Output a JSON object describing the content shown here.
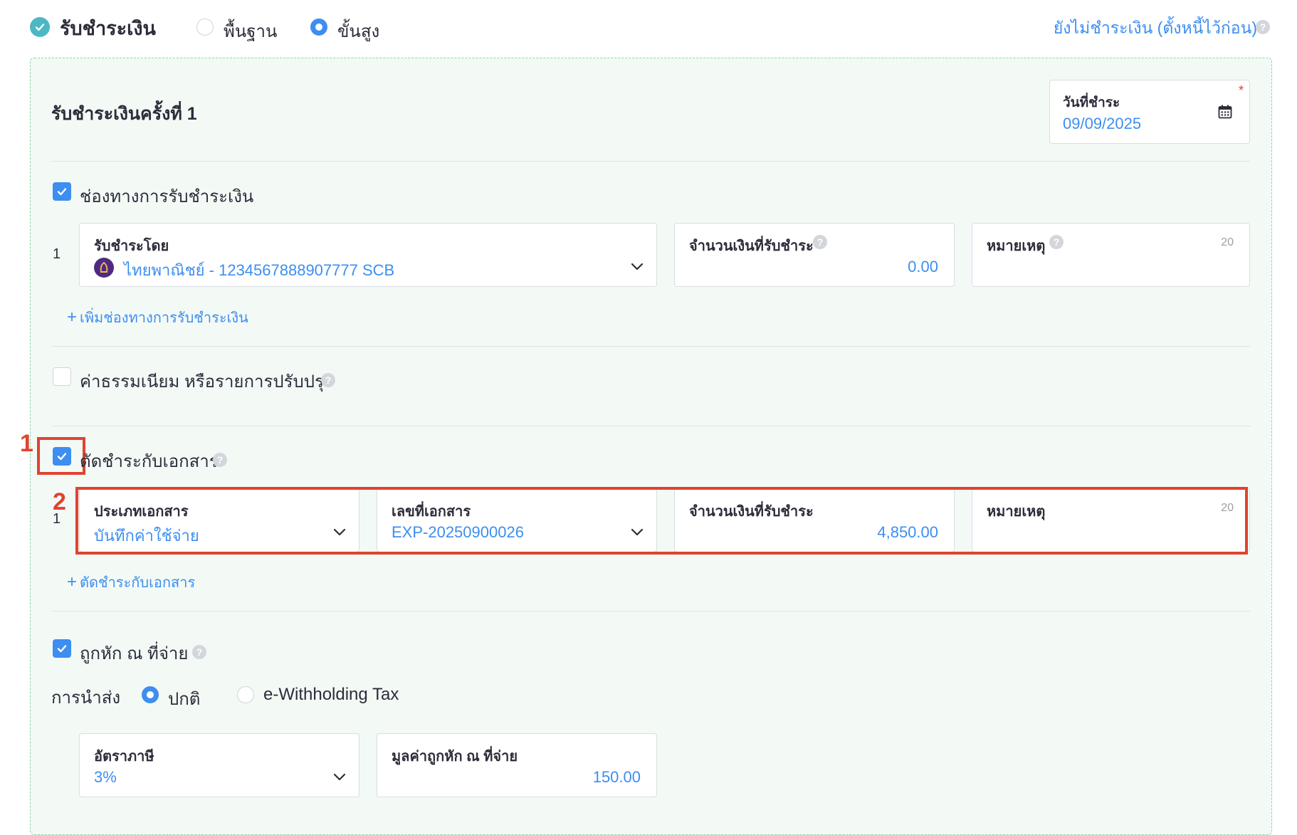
{
  "header": {
    "title": "รับชำระเงิน",
    "mode_basic": "พื้นฐาน",
    "mode_advanced": "ขั้นสูง",
    "unpaid_link": "ยังไม่ชำระเงิน (ตั้งหนี้ไว้ก่อน)"
  },
  "payment": {
    "title": "รับชำระเงินครั้งที่ 1",
    "date_label": "วันที่ชำระ",
    "date_value": "09/09/2025",
    "required_mark": "*"
  },
  "channels": {
    "label": "ช่องทางการรับชำระเงิน",
    "row_number": "1",
    "received_by_label": "รับชำระโดย",
    "received_by_value": "ไทยพาณิชย์ - 1234567888907777 SCB",
    "amount_label": "จำนวนเงินที่รับชำระ",
    "amount_value": "0.00",
    "note_label": "หมายเหตุ",
    "note_count": "20",
    "add_link": "เพิ่มช่องทางการรับชำระเงิน"
  },
  "fees": {
    "label": "ค่าธรรมเนียม หรือรายการปรับปรุง"
  },
  "offset": {
    "label": "ตัดชำระกับเอกสาร",
    "row_number": "1",
    "doc_type_label": "ประเภทเอกสาร",
    "doc_type_value": "บันทึกค่าใช้จ่าย",
    "doc_no_label": "เลขที่เอกสาร",
    "doc_no_value": "EXP-20250900026",
    "amount_label": "จำนวนเงินที่รับชำระ",
    "amount_value": "4,850.00",
    "note_label": "หมายเหตุ",
    "note_count": "20",
    "add_link": "ตัดชำระกับเอกสาร"
  },
  "withholding": {
    "label": "ถูกหัก ณ ที่จ่าย",
    "delivery_label": "การนำส่ง",
    "option_normal": "ปกติ",
    "option_ewht": "e-Withholding Tax",
    "rate_label": "อัตราภาษี",
    "rate_value": "3%",
    "amount_label": "มูลค่าถูกหัก ณ ที่จ่าย",
    "amount_value": "150.00"
  },
  "annotations": {
    "marker_1": "1",
    "marker_2": "2"
  },
  "icons": {
    "help": "?",
    "add": "+"
  },
  "colors": {
    "accent": "#3d8ef0",
    "panel_bg": "#f3faf6",
    "annotation_red": "#e0432f",
    "success_teal": "#4bb8c4"
  }
}
